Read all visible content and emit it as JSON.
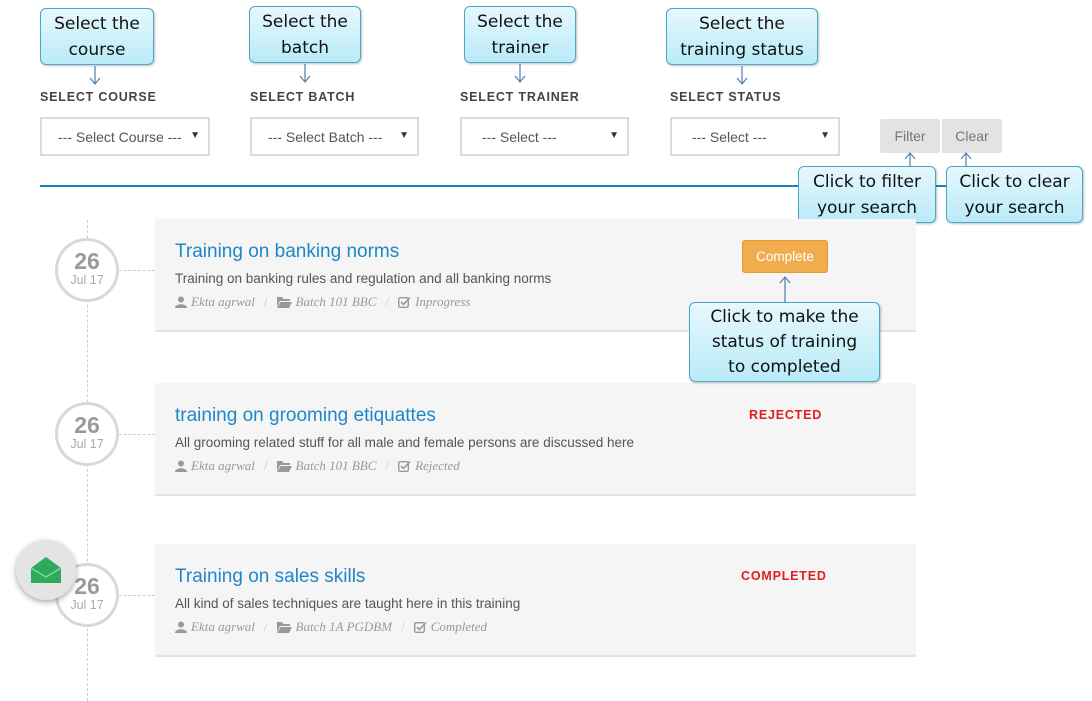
{
  "callouts": {
    "course": [
      "Select the",
      "course"
    ],
    "batch": [
      "Select the",
      "batch"
    ],
    "trainer": [
      "Select the",
      "trainer"
    ],
    "status": [
      "Select the",
      "training status"
    ],
    "filter": [
      "Click to filter",
      "your search"
    ],
    "clear": [
      "Click to clear",
      "your search"
    ],
    "complete": [
      "Click to make the",
      "status of training",
      "to completed"
    ]
  },
  "filters": {
    "course_label": "SELECT COURSE",
    "course_value": "--- Select Course ---",
    "batch_label": "SELECT BATCH",
    "batch_value": "--- Select Batch ---",
    "trainer_label": "SELECT TRAINER",
    "trainer_value": "--- Select ---",
    "status_label": "SELECT STATUS",
    "status_value": "--- Select ---",
    "filter_button": "Filter",
    "clear_button": "Clear"
  },
  "trainings": [
    {
      "day": "26",
      "month": "Jul 17",
      "title": "Training on banking norms",
      "description": "Training on banking rules and regulation and all banking norms",
      "trainer": "Ekta agrwal",
      "batch": "Batch 101 BBC",
      "status": "Inprogress",
      "action_label": "Complete"
    },
    {
      "day": "26",
      "month": "Jul 17",
      "title": "training on grooming etiquattes",
      "description": "All grooming related stuff for all male and female persons are discussed here",
      "trainer": "Ekta agrwal",
      "batch": "Batch 101 BBC",
      "status": "Rejected",
      "status_badge": "REJECTED"
    },
    {
      "day": "26",
      "month": "Jul 17",
      "title": "Training on sales skills",
      "description": "All kind of sales techniques are taught here in this training",
      "trainer": "Ekta agrwal",
      "batch": "Batch 1A PGDBM",
      "status": "Completed",
      "status_badge": "COMPLETED"
    }
  ],
  "colors": {
    "accent": "#1f87c9",
    "complete_button": "#f0ad4e",
    "status_red": "#e02020",
    "fab_green": "#2eaa5a"
  },
  "icons": {
    "trainer": "user-icon",
    "batch": "folder-icon",
    "status": "check-square-icon",
    "fab": "mail-icon"
  }
}
